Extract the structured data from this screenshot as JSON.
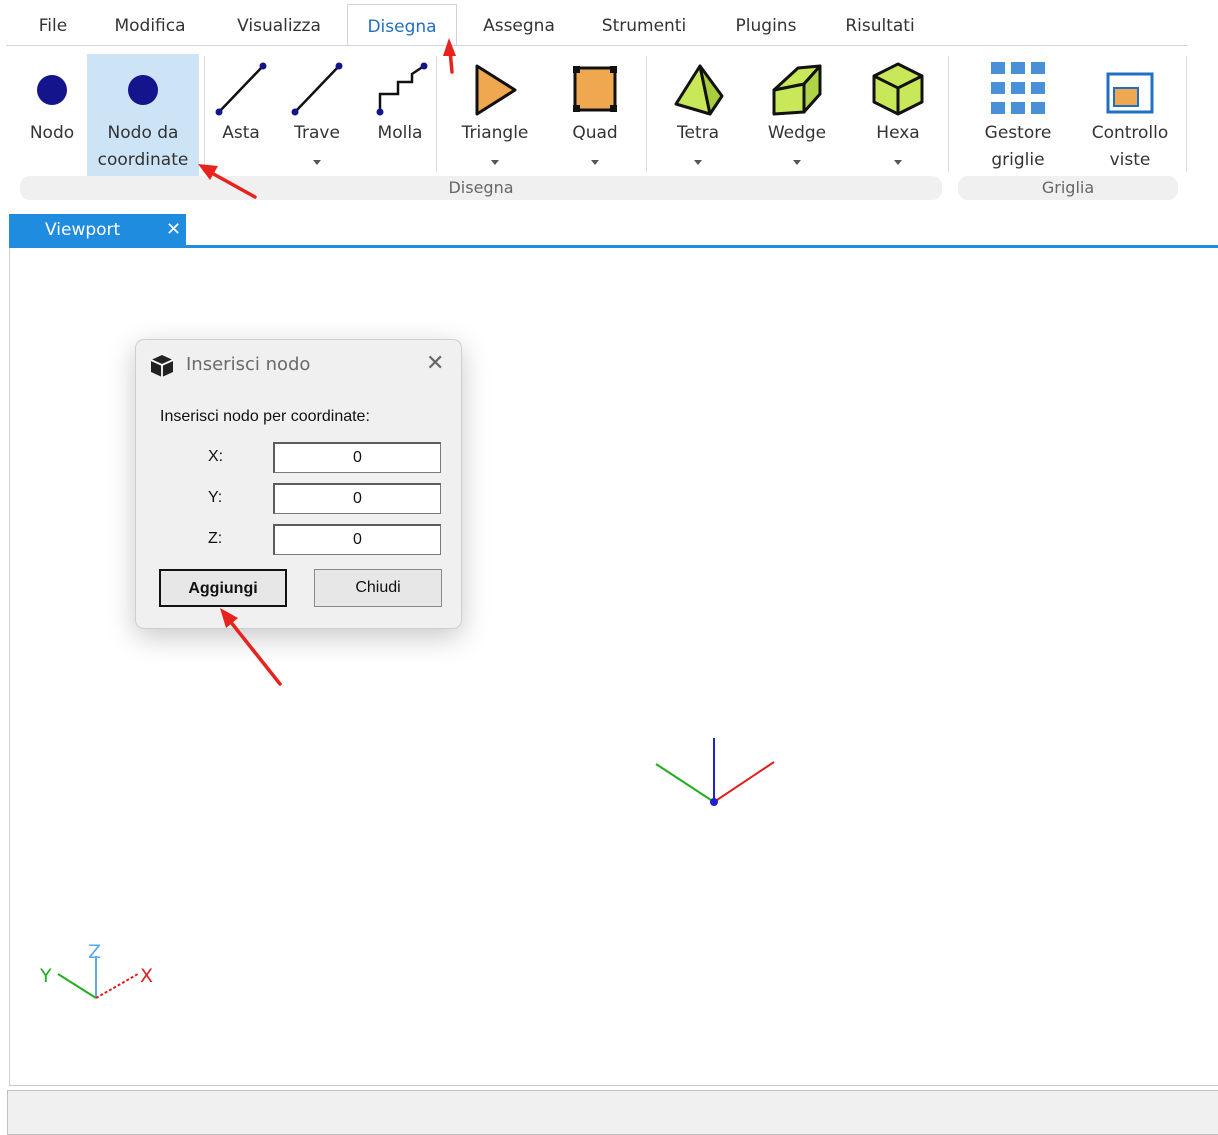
{
  "menu": {
    "tabs": [
      {
        "label": "File"
      },
      {
        "label": "Modifica"
      },
      {
        "label": "Visualizza"
      },
      {
        "label": "Disegna"
      },
      {
        "label": "Assegna"
      },
      {
        "label": "Strumenti"
      },
      {
        "label": "Plugins"
      },
      {
        "label": "Risultati"
      }
    ],
    "active_tab": "Disegna"
  },
  "ribbon": {
    "buttons": {
      "nodo": "Nodo",
      "nodo_coord_1": "Nodo da",
      "nodo_coord_2": "coordinate",
      "asta": "Asta",
      "trave": "Trave",
      "molla": "Molla",
      "triangle": "Triangle",
      "quad": "Quad",
      "tetra": "Tetra",
      "wedge": "Wedge",
      "hexa": "Hexa",
      "gestore_1": "Gestore",
      "gestore_2": "griglie",
      "controllo_1": "Controllo",
      "controllo_2": "viste"
    },
    "groups": {
      "disegna": "Disegna",
      "griglia": "Griglia"
    }
  },
  "viewport_tab": {
    "label": "Viewport",
    "close": "✕"
  },
  "dialog": {
    "title": "Inserisci nodo",
    "close": "✕",
    "prompt": "Inserisci nodo per coordinate:",
    "fields": {
      "x_label": "X:",
      "x_value": "0",
      "y_label": "Y:",
      "y_value": "0",
      "z_label": "Z:",
      "z_value": "0"
    },
    "add_button": "Aggiungi",
    "close_button": "Chiudi"
  },
  "triad": {
    "x": "X",
    "y": "Y",
    "z": "Z"
  },
  "colors": {
    "accent": "#1f8ce0",
    "selected_bg": "#cde4f7",
    "node": "#14148c",
    "shape_fill_green": "#c8e85a",
    "shape_fill_orange": "#f0a850",
    "axis_x": "#e02020",
    "axis_y": "#20b020",
    "axis_z": "#2020d0",
    "annotation": "#e8231e"
  },
  "icons": [
    "node-icon",
    "node-coordinates-icon",
    "bar-icon",
    "beam-icon",
    "spring-icon",
    "triangle-icon",
    "quad-icon",
    "tetra-icon",
    "wedge-icon",
    "hexa-icon",
    "grid-manager-icon",
    "view-control-icon",
    "cube-icon",
    "close-icon"
  ]
}
